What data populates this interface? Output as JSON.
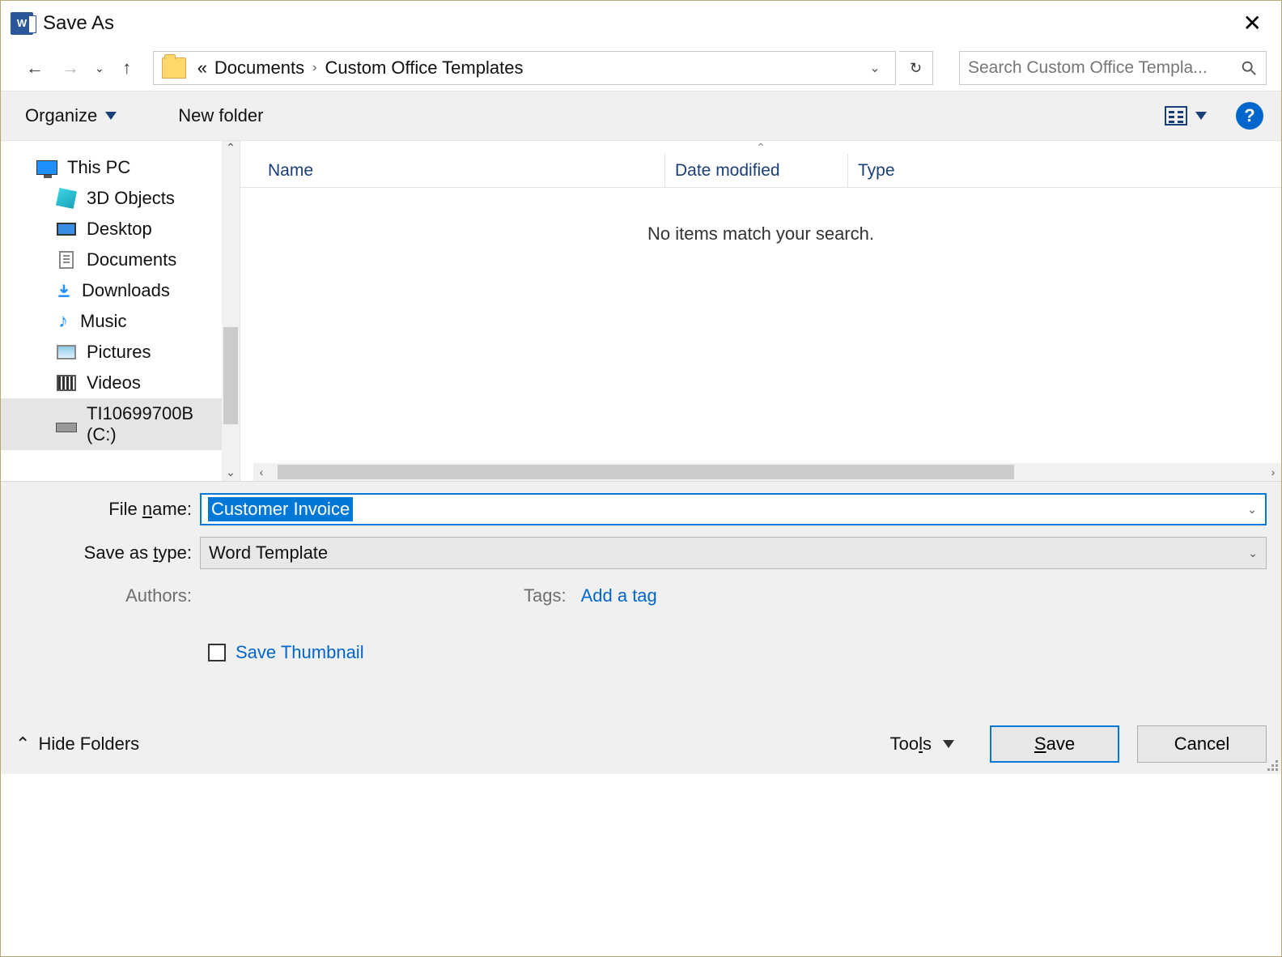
{
  "title": "Save As",
  "breadcrumb": {
    "prefix": "«",
    "seg1": "Documents",
    "seg2": "Custom Office Templates"
  },
  "search": {
    "placeholder": "Search Custom Office Templa..."
  },
  "toolbar": {
    "organize": "Organize",
    "new_folder": "New folder"
  },
  "tree": {
    "root": "This PC",
    "items": [
      "3D Objects",
      "Desktop",
      "Documents",
      "Downloads",
      "Music",
      "Pictures",
      "Videos",
      "TI10699700B (C:)"
    ]
  },
  "columns": {
    "name": "Name",
    "date": "Date modified",
    "type": "Type"
  },
  "empty_msg": "No items match your search.",
  "fields": {
    "filename_label": "File name:",
    "filename_value": "Customer Invoice",
    "savetype_label": "Save as type:",
    "savetype_value": "Word Template",
    "authors_label": "Authors:",
    "authors_value": "",
    "tags_label": "Tags:",
    "tags_value": "Add a tag",
    "save_thumbnail": "Save Thumbnail"
  },
  "footer": {
    "hide": "Hide Folders",
    "tools": "Tools",
    "save": "Save",
    "cancel": "Cancel"
  }
}
